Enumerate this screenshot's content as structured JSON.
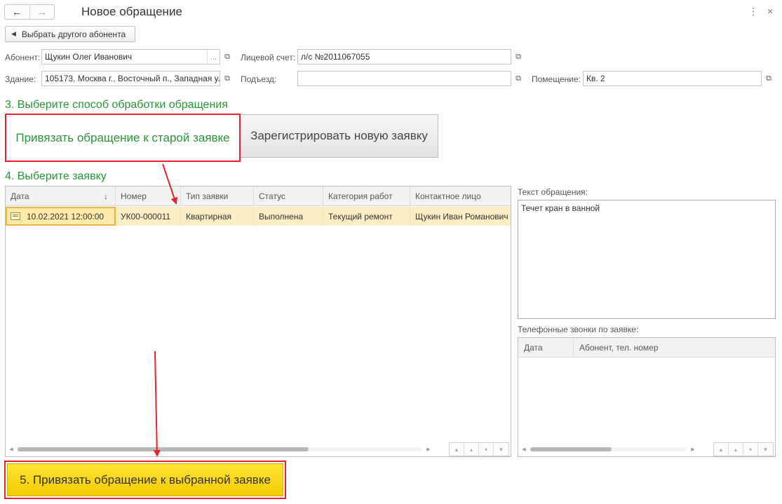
{
  "window": {
    "title": "Новое обращение",
    "menu_glyph": "⋮",
    "close_glyph": "×"
  },
  "back_button": {
    "label": "Выбрать другого абонента"
  },
  "fields": {
    "subscriber": {
      "label": "Абонент:",
      "value": "Щукин Олег Иванович",
      "dots": "..."
    },
    "account": {
      "label": "Лицевой счет:",
      "value": "л/с №2011067055"
    },
    "building": {
      "label": "Здание:",
      "value": "105173, Москва г., Восточный п., Западная ул"
    },
    "entrance": {
      "label": "Подъезд:",
      "value": ""
    },
    "room": {
      "label": "Помещение:",
      "value": "Кв. 2"
    }
  },
  "step3": {
    "heading": "3. Выберите способ обработки обращения",
    "option_old": "Привязать обращение к старой заявке",
    "option_new": "Зарегистрировать новую заявку"
  },
  "step4": {
    "heading": "4. Выберите заявку",
    "sort_glyph": "↓",
    "columns": [
      "Дата",
      "Номер",
      "Тип заявки",
      "Статус",
      "Категория работ",
      "Контактное лицо"
    ],
    "rows": [
      [
        "10.02.2021 12:00:00",
        "УК00-000011",
        "Квартирная",
        "Выполнена",
        "Текущий ремонт",
        "Щукин Иван Романович"
      ]
    ]
  },
  "appeal_text": {
    "label": "Текст обращения:",
    "value": "Течет кран в ванной"
  },
  "calls": {
    "label": "Телефонные звонки по заявке:",
    "columns": [
      "Дата",
      "Абонент, тел. номер"
    ]
  },
  "step5": {
    "button": "5. Привязать обращение к выбранной заявке"
  },
  "colors": {
    "accent_green": "#2a9438",
    "highlight_red": "#e5232b",
    "primary_yellow": "#f3cc00",
    "selected_row": "#fbeec5"
  }
}
